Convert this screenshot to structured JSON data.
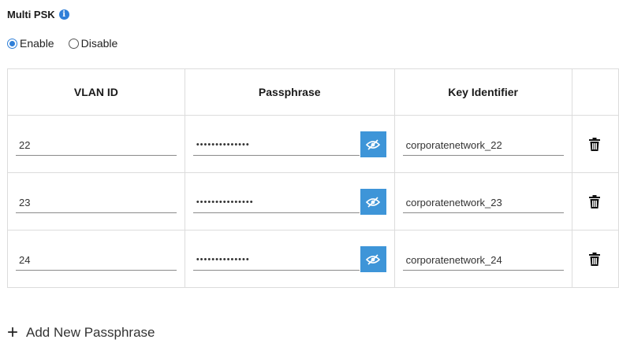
{
  "section": {
    "title": "Multi PSK",
    "info_icon": "info-icon"
  },
  "radio": {
    "enable_label": "Enable",
    "disable_label": "Disable",
    "selected": "Enable"
  },
  "table": {
    "headers": [
      "VLAN ID",
      "Passphrase",
      "Key Identifier",
      ""
    ],
    "rows": [
      {
        "vlan": "22",
        "passphrase": "••••••••••••••",
        "key_id": "corporatenetwork_22"
      },
      {
        "vlan": "23",
        "passphrase": "•••••••••••••••",
        "key_id": "corporatenetwork_23"
      },
      {
        "vlan": "24",
        "passphrase": "••••••••••••••",
        "key_id": "corporatenetwork_24"
      }
    ]
  },
  "add_button": {
    "label": "Add New Passphrase"
  },
  "colors": {
    "accent": "#3e95d8",
    "radio_selected": "#2f7fd8"
  }
}
